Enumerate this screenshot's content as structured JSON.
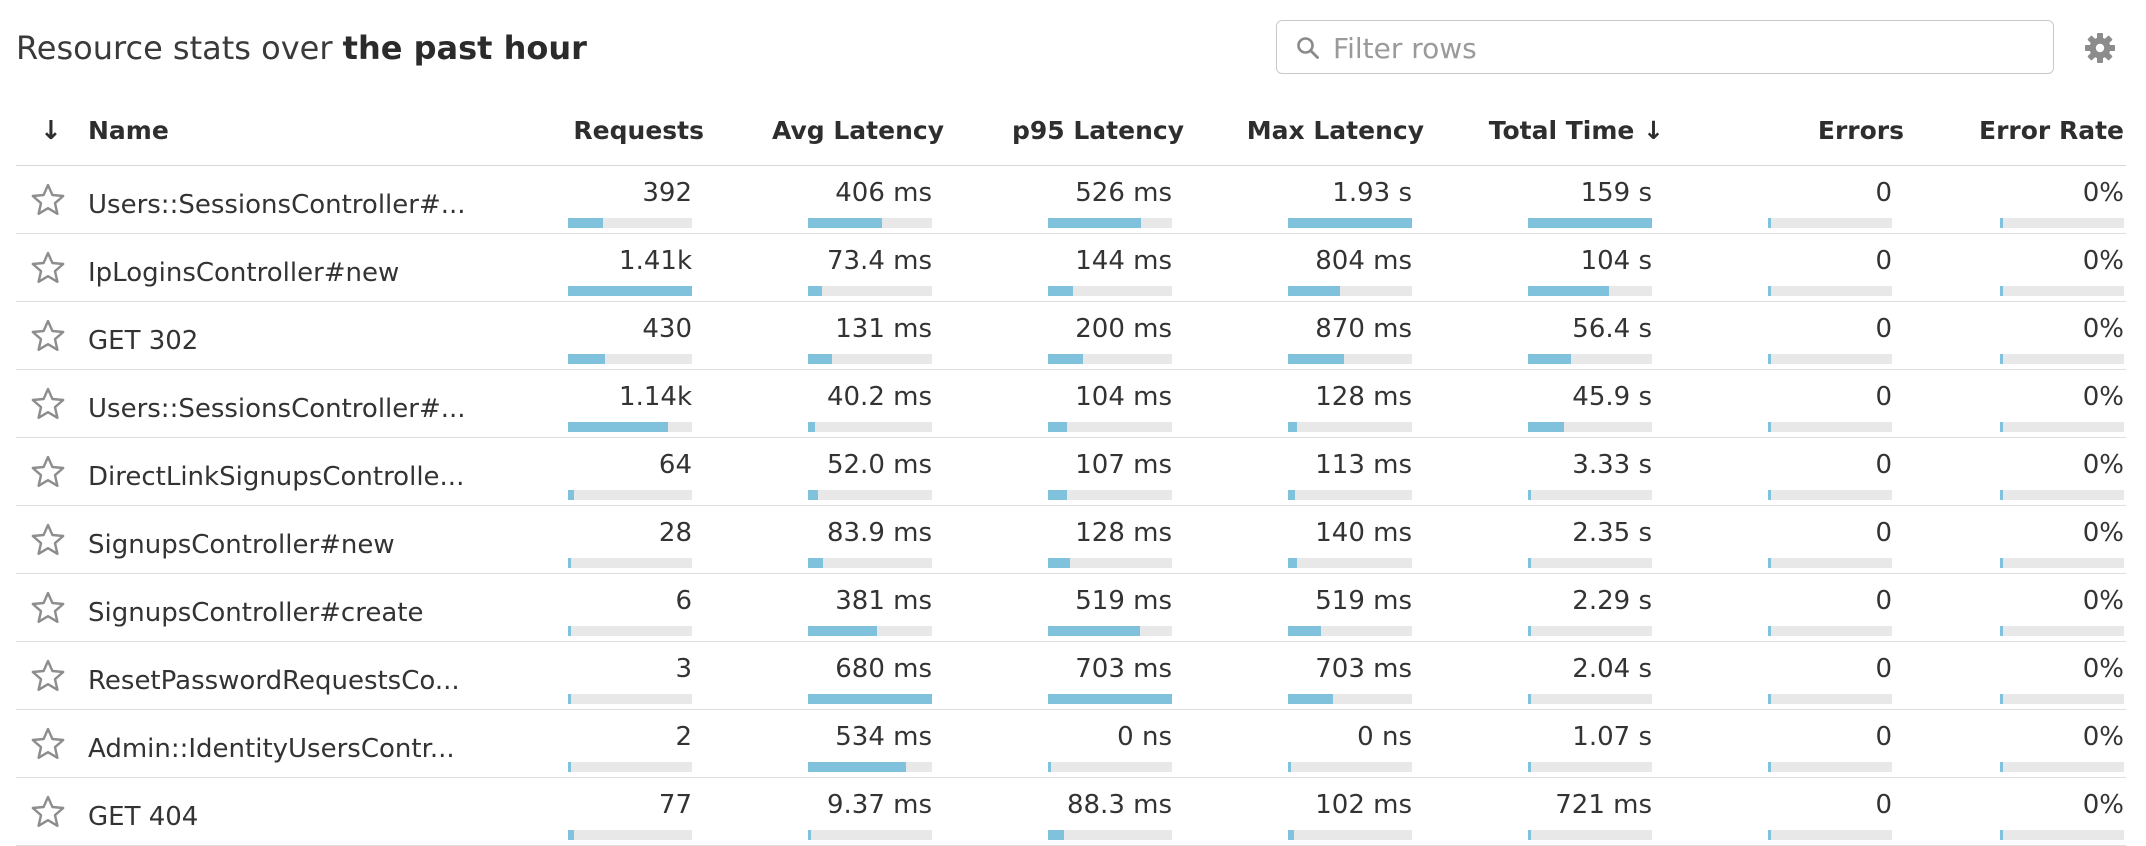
{
  "header": {
    "title_prefix": "Resource stats over ",
    "title_bold": "the past hour",
    "filter_placeholder": "Filter rows",
    "filter_value": ""
  },
  "icons": {
    "filter": "search-icon",
    "settings": "gear-icon",
    "favorite": "star-outline-icon",
    "sort": "arrow-down-icon"
  },
  "colors": {
    "bar_fill": "#80c1dc",
    "bar_track": "#e8e8e8"
  },
  "table": {
    "columns": {
      "sort": "↓",
      "name": "Name",
      "requests": "Requests",
      "avg_latency": "Avg Latency",
      "p95_latency": "p95 Latency",
      "max_latency": "Max Latency",
      "total_time": "Total Time ↓",
      "errors": "Errors",
      "error_rate": "Error Rate"
    },
    "rows": [
      {
        "name": "Users::SessionsController#...",
        "requests": "392",
        "requests_pct": 0.28,
        "avg_latency": "406 ms",
        "avg_latency_pct": 0.6,
        "p95_latency": "526 ms",
        "p95_latency_pct": 0.75,
        "max_latency": "1.93 s",
        "max_latency_pct": 1.0,
        "total_time": "159 s",
        "total_time_pct": 1.0,
        "errors": "0",
        "errors_pct": 0,
        "error_rate": "0%",
        "error_rate_pct": 0
      },
      {
        "name": "IpLoginsController#new",
        "requests": "1.41k",
        "requests_pct": 1.0,
        "avg_latency": "73.4 ms",
        "avg_latency_pct": 0.11,
        "p95_latency": "144 ms",
        "p95_latency_pct": 0.2,
        "max_latency": "804 ms",
        "max_latency_pct": 0.42,
        "total_time": "104 s",
        "total_time_pct": 0.65,
        "errors": "0",
        "errors_pct": 0,
        "error_rate": "0%",
        "error_rate_pct": 0
      },
      {
        "name": "GET 302",
        "requests": "430",
        "requests_pct": 0.3,
        "avg_latency": "131 ms",
        "avg_latency_pct": 0.19,
        "p95_latency": "200 ms",
        "p95_latency_pct": 0.28,
        "max_latency": "870 ms",
        "max_latency_pct": 0.45,
        "total_time": "56.4 s",
        "total_time_pct": 0.35,
        "errors": "0",
        "errors_pct": 0,
        "error_rate": "0%",
        "error_rate_pct": 0
      },
      {
        "name": "Users::SessionsController#...",
        "requests": "1.14k",
        "requests_pct": 0.81,
        "avg_latency": "40.2 ms",
        "avg_latency_pct": 0.06,
        "p95_latency": "104 ms",
        "p95_latency_pct": 0.15,
        "max_latency": "128 ms",
        "max_latency_pct": 0.07,
        "total_time": "45.9 s",
        "total_time_pct": 0.29,
        "errors": "0",
        "errors_pct": 0,
        "error_rate": "0%",
        "error_rate_pct": 0
      },
      {
        "name": "DirectLinkSignupsControlle...",
        "requests": "64",
        "requests_pct": 0.05,
        "avg_latency": "52.0 ms",
        "avg_latency_pct": 0.08,
        "p95_latency": "107 ms",
        "p95_latency_pct": 0.15,
        "max_latency": "113 ms",
        "max_latency_pct": 0.06,
        "total_time": "3.33 s",
        "total_time_pct": 0.02,
        "errors": "0",
        "errors_pct": 0,
        "error_rate": "0%",
        "error_rate_pct": 0
      },
      {
        "name": "SignupsController#new",
        "requests": "28",
        "requests_pct": 0.02,
        "avg_latency": "83.9 ms",
        "avg_latency_pct": 0.12,
        "p95_latency": "128 ms",
        "p95_latency_pct": 0.18,
        "max_latency": "140 ms",
        "max_latency_pct": 0.07,
        "total_time": "2.35 s",
        "total_time_pct": 0.015,
        "errors": "0",
        "errors_pct": 0,
        "error_rate": "0%",
        "error_rate_pct": 0
      },
      {
        "name": "SignupsController#create",
        "requests": "6",
        "requests_pct": 0.01,
        "avg_latency": "381 ms",
        "avg_latency_pct": 0.56,
        "p95_latency": "519 ms",
        "p95_latency_pct": 0.74,
        "max_latency": "519 ms",
        "max_latency_pct": 0.27,
        "total_time": "2.29 s",
        "total_time_pct": 0.015,
        "errors": "0",
        "errors_pct": 0,
        "error_rate": "0%",
        "error_rate_pct": 0
      },
      {
        "name": "ResetPasswordRequestsCo...",
        "requests": "3",
        "requests_pct": 0.005,
        "avg_latency": "680 ms",
        "avg_latency_pct": 1.0,
        "p95_latency": "703 ms",
        "p95_latency_pct": 1.0,
        "max_latency": "703 ms",
        "max_latency_pct": 0.36,
        "total_time": "2.04 s",
        "total_time_pct": 0.013,
        "errors": "0",
        "errors_pct": 0,
        "error_rate": "0%",
        "error_rate_pct": 0
      },
      {
        "name": "Admin::IdentityUsersContr...",
        "requests": "2",
        "requests_pct": 0.003,
        "avg_latency": "534 ms",
        "avg_latency_pct": 0.79,
        "p95_latency": "0 ns",
        "p95_latency_pct": 0,
        "max_latency": "0 ns",
        "max_latency_pct": 0,
        "total_time": "1.07 s",
        "total_time_pct": 0.007,
        "errors": "0",
        "errors_pct": 0,
        "error_rate": "0%",
        "error_rate_pct": 0
      },
      {
        "name": "GET 404",
        "requests": "77",
        "requests_pct": 0.05,
        "avg_latency": "9.37 ms",
        "avg_latency_pct": 0.014,
        "p95_latency": "88.3 ms",
        "p95_latency_pct": 0.13,
        "max_latency": "102 ms",
        "max_latency_pct": 0.05,
        "total_time": "721 ms",
        "total_time_pct": 0.005,
        "errors": "0",
        "errors_pct": 0,
        "error_rate": "0%",
        "error_rate_pct": 0
      }
    ]
  }
}
